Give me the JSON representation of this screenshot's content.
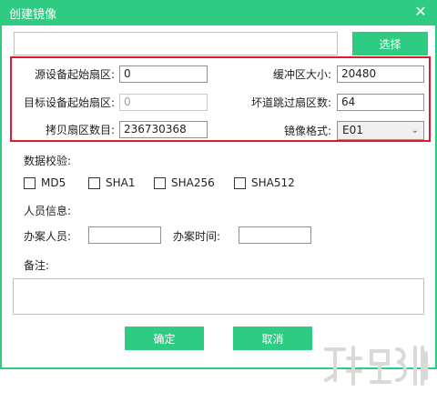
{
  "window": {
    "title": "创建镜像"
  },
  "path_input": {
    "value": ""
  },
  "buttons": {
    "select": "选择",
    "ok": "确定",
    "cancel": "取消"
  },
  "form": {
    "source_start_label": "源设备起始扇区:",
    "source_start_value": "0",
    "target_start_label": "目标设备起始扇区:",
    "target_start_value": "0",
    "copy_count_label": "拷贝扇区数目:",
    "copy_count_value": "236730368",
    "buffer_label": "缓冲区大小:",
    "buffer_value": "20480",
    "skip_label": "坏道跳过扇区数:",
    "skip_value": "64",
    "format_label": "镜像格式:",
    "format_value": "E01"
  },
  "checksum": {
    "label": "数据校验:",
    "options": [
      "MD5",
      "SHA1",
      "SHA256",
      "SHA512"
    ]
  },
  "person": {
    "section_label": "人员信息:",
    "handler_label": "办案人员:",
    "handler_value": "",
    "time_label": "办案时间:",
    "time_value": ""
  },
  "notes": {
    "label": "备注:",
    "value": ""
  },
  "colors": {
    "accent": "#2ecb82",
    "highlight": "#e0192c"
  }
}
